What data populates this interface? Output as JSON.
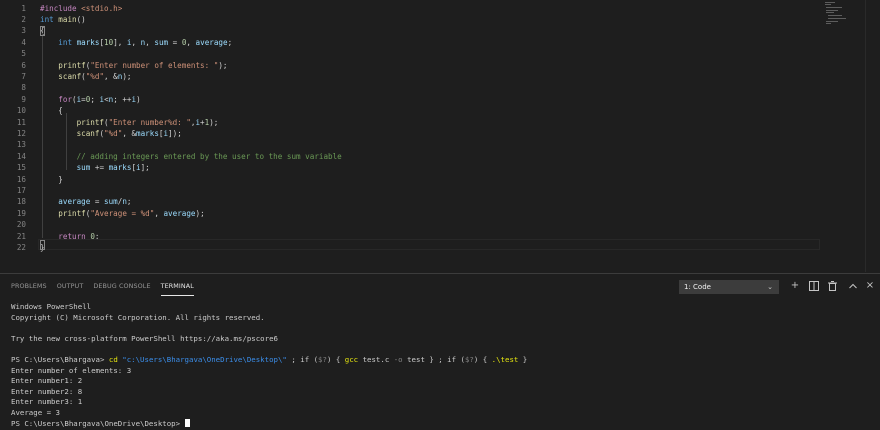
{
  "editor": {
    "lines": [
      {
        "n": "1",
        "tokens": [
          [
            "pre",
            "#include "
          ],
          [
            "inc",
            "<stdio.h>"
          ]
        ]
      },
      {
        "n": "2",
        "tokens": [
          [
            "ty",
            "int "
          ],
          [
            "fn",
            "main"
          ],
          [
            "",
            "()"
          ]
        ]
      },
      {
        "n": "3",
        "tokens": [
          [
            "",
            "{"
          ]
        ]
      },
      {
        "n": "4",
        "tokens": [
          [
            "",
            "    "
          ],
          [
            "ty",
            "int "
          ],
          [
            "var",
            "marks"
          ],
          [
            "",
            "["
          ],
          [
            "num",
            "10"
          ],
          [
            "",
            "], "
          ],
          [
            "var",
            "i"
          ],
          [
            "",
            ", "
          ],
          [
            "var",
            "n"
          ],
          [
            "",
            ", "
          ],
          [
            "var",
            "sum"
          ],
          [
            "",
            " = "
          ],
          [
            "num",
            "0"
          ],
          [
            "",
            ", "
          ],
          [
            "var",
            "average"
          ],
          [
            "",
            ";"
          ]
        ]
      },
      {
        "n": "5",
        "tokens": []
      },
      {
        "n": "6",
        "tokens": [
          [
            "",
            "    "
          ],
          [
            "fn",
            "printf"
          ],
          [
            "",
            "("
          ],
          [
            "str",
            "\"Enter number of elements: \""
          ],
          [
            "",
            ");"
          ]
        ]
      },
      {
        "n": "7",
        "tokens": [
          [
            "",
            "    "
          ],
          [
            "fn",
            "scanf"
          ],
          [
            "",
            "("
          ],
          [
            "str",
            "\"%d\""
          ],
          [
            "",
            ", &"
          ],
          [
            "var",
            "n"
          ],
          [
            "",
            ");"
          ]
        ]
      },
      {
        "n": "8",
        "tokens": []
      },
      {
        "n": "9",
        "tokens": [
          [
            "",
            "    "
          ],
          [
            "ctl",
            "for"
          ],
          [
            "",
            "("
          ],
          [
            "var",
            "i"
          ],
          [
            "",
            "="
          ],
          [
            "num",
            "0"
          ],
          [
            "",
            "; "
          ],
          [
            "var",
            "i"
          ],
          [
            "",
            "<"
          ],
          [
            "var",
            "n"
          ],
          [
            "",
            "; ++"
          ],
          [
            "var",
            "i"
          ],
          [
            "",
            ")"
          ]
        ]
      },
      {
        "n": "10",
        "tokens": [
          [
            "",
            "    {"
          ]
        ]
      },
      {
        "n": "11",
        "tokens": [
          [
            "",
            "        "
          ],
          [
            "fn",
            "printf"
          ],
          [
            "",
            "("
          ],
          [
            "str",
            "\"Enter number%d: \""
          ],
          [
            "",
            ","
          ],
          [
            "var",
            "i"
          ],
          [
            "",
            "+"
          ],
          [
            "num",
            "1"
          ],
          [
            "",
            ");"
          ]
        ]
      },
      {
        "n": "12",
        "tokens": [
          [
            "",
            "        "
          ],
          [
            "fn",
            "scanf"
          ],
          [
            "",
            "("
          ],
          [
            "str",
            "\"%d\""
          ],
          [
            "",
            ", &"
          ],
          [
            "var",
            "marks"
          ],
          [
            "",
            "["
          ],
          [
            "var",
            "i"
          ],
          [
            "",
            "]);"
          ]
        ]
      },
      {
        "n": "13",
        "tokens": []
      },
      {
        "n": "14",
        "tokens": [
          [
            "",
            "        "
          ],
          [
            "cmt",
            "// adding integers entered by the user to the sum variable"
          ]
        ]
      },
      {
        "n": "15",
        "tokens": [
          [
            "",
            "        "
          ],
          [
            "var",
            "sum"
          ],
          [
            "",
            " += "
          ],
          [
            "var",
            "marks"
          ],
          [
            "",
            "["
          ],
          [
            "var",
            "i"
          ],
          [
            "",
            "];"
          ]
        ]
      },
      {
        "n": "16",
        "tokens": [
          [
            "",
            "    }"
          ]
        ]
      },
      {
        "n": "17",
        "tokens": []
      },
      {
        "n": "18",
        "tokens": [
          [
            "",
            "    "
          ],
          [
            "var",
            "average"
          ],
          [
            "",
            " = "
          ],
          [
            "var",
            "sum"
          ],
          [
            "",
            "/"
          ],
          [
            "var",
            "n"
          ],
          [
            "",
            ";"
          ]
        ]
      },
      {
        "n": "19",
        "tokens": [
          [
            "",
            "    "
          ],
          [
            "fn",
            "printf"
          ],
          [
            "",
            "("
          ],
          [
            "str",
            "\"Average = %d\""
          ],
          [
            "",
            ", "
          ],
          [
            "var",
            "average"
          ],
          [
            "",
            ");"
          ]
        ]
      },
      {
        "n": "20",
        "tokens": []
      },
      {
        "n": "21",
        "tokens": [
          [
            "",
            "    "
          ],
          [
            "ctl",
            "return "
          ],
          [
            "num",
            "0"
          ],
          [
            "",
            ";"
          ]
        ]
      },
      {
        "n": "22",
        "tokens": [
          [
            "",
            "}"
          ]
        ]
      }
    ]
  },
  "panel": {
    "tabs": [
      {
        "label": "PROBLEMS",
        "active": false
      },
      {
        "label": "OUTPUT",
        "active": false
      },
      {
        "label": "DEBUG CONSOLE",
        "active": false
      },
      {
        "label": "TERMINAL",
        "active": true
      }
    ],
    "terminal_select": "1: Code",
    "icons": {
      "new_terminal": "+",
      "split": "◫",
      "kill": "🗑",
      "maximize": "^",
      "close": "×"
    }
  },
  "terminal": {
    "line1": "Windows PowerShell",
    "line2": "Copyright (C) Microsoft Corporation. All rights reserved.",
    "line3": "",
    "line4": "Try the new cross-platform PowerShell https://aka.ms/pscore6",
    "line5": "",
    "cmd": {
      "prompt": "PS C:\\Users\\Bhargava> ",
      "cd": "cd",
      "path": " \"c:\\Users\\Bhargava\\OneDrive\\Desktop\\\"",
      "p1": " ; if (",
      "q1": "$?",
      "p2": ") { ",
      "gcc": "gcc",
      "gccargs": " test.c ",
      "oflag": "-o",
      "p3": " test } ; if (",
      "q2": "$?",
      "p4": ") { ",
      "run": ".\\test",
      "p5": " }"
    },
    "out1": "Enter number of elements: 3",
    "out2": "Enter number1: 2",
    "out3": "Enter number2: 8",
    "out4": "Enter number3: 1",
    "out5": "Average = 3",
    "final_prompt": "PS C:\\Users\\Bhargava\\OneDrive\\Desktop> "
  }
}
